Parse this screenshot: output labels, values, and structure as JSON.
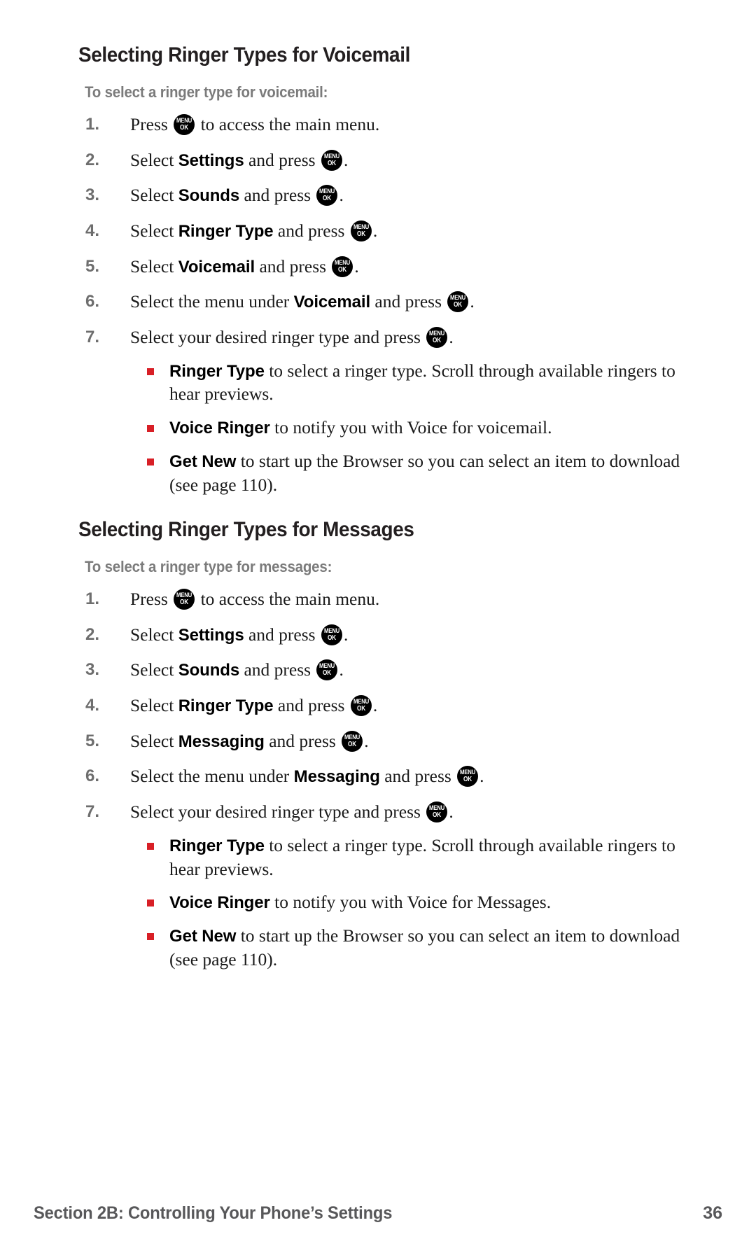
{
  "page": {
    "number": "36",
    "footer_text": "Section 2B: Controlling Your Phone’s Settings",
    "accent_bullet_color": "#d81f26",
    "heading_color": "#231f20",
    "subheading_color": "#7b7b7b",
    "number_color": "#6e6e6e",
    "footer_color": "#58585a"
  },
  "menu_key": {
    "name": "menu-ok-key-icon",
    "line1": "MENU",
    "line2": "OK"
  },
  "sections": [
    {
      "heading": "Selecting Ringer Types for Voicemail",
      "subheading": "To select a ringer type for voicemail:",
      "steps": [
        {
          "num": "1.",
          "pre": "Press ",
          "term": "",
          "mid": "",
          "key": true,
          "post": " to access the main menu."
        },
        {
          "num": "2.",
          "pre": "Select ",
          "term": "Settings",
          "mid": " and press ",
          "key": true,
          "post": "."
        },
        {
          "num": "3.",
          "pre": "Select ",
          "term": "Sounds",
          "mid": " and press ",
          "key": true,
          "post": "."
        },
        {
          "num": "4.",
          "pre": "Select ",
          "term": "Ringer Type",
          "mid": " and press ",
          "key": true,
          "post": "."
        },
        {
          "num": "5.",
          "pre": "Select ",
          "term": "Voicemail",
          "mid": " and press ",
          "key": true,
          "post": "."
        },
        {
          "num": "6.",
          "pre": "Select the menu under ",
          "term": "Voicemail",
          "mid": " and press ",
          "key": true,
          "post": "."
        },
        {
          "num": "7.",
          "pre": "Select your desired ringer type and press ",
          "term": "",
          "mid": "",
          "key": true,
          "post": "."
        }
      ],
      "bullets": [
        {
          "term": "Ringer Type",
          "text": " to select a ringer type. Scroll through available ringers to hear previews."
        },
        {
          "term": "Voice Ringer",
          "text": " to notify you with Voice for voicemail."
        },
        {
          "term": "Get New",
          "text": " to start up the Browser so you can select an item to download (see page 110)."
        }
      ]
    },
    {
      "heading": "Selecting Ringer Types for Messages",
      "subheading": "To select a ringer type for messages:",
      "steps": [
        {
          "num": "1.",
          "pre": "Press ",
          "term": "",
          "mid": "",
          "key": true,
          "post": " to access the main menu."
        },
        {
          "num": "2.",
          "pre": "Select ",
          "term": "Settings",
          "mid": " and press ",
          "key": true,
          "post": "."
        },
        {
          "num": "3.",
          "pre": "Select ",
          "term": "Sounds",
          "mid": " and press ",
          "key": true,
          "post": "."
        },
        {
          "num": "4.",
          "pre": "Select ",
          "term": "Ringer Type",
          "mid": " and press ",
          "key": true,
          "post": "."
        },
        {
          "num": "5.",
          "pre": "Select ",
          "term": "Messaging",
          "mid": " and press ",
          "key": true,
          "post": "."
        },
        {
          "num": "6.",
          "pre": "Select the menu under ",
          "term": "Messaging",
          "mid": " and press ",
          "key": true,
          "post": "."
        },
        {
          "num": "7.",
          "pre": "Select your desired ringer type and press ",
          "term": "",
          "mid": "",
          "key": true,
          "post": "."
        }
      ],
      "bullets": [
        {
          "term": "Ringer Type",
          "text": " to select a ringer type. Scroll through available ringers to hear previews."
        },
        {
          "term": "Voice Ringer",
          "text": " to notify you with Voice for Messages."
        },
        {
          "term": "Get New",
          "text": " to start up the Browser so you can select an item to download (see page 110)."
        }
      ]
    }
  ]
}
